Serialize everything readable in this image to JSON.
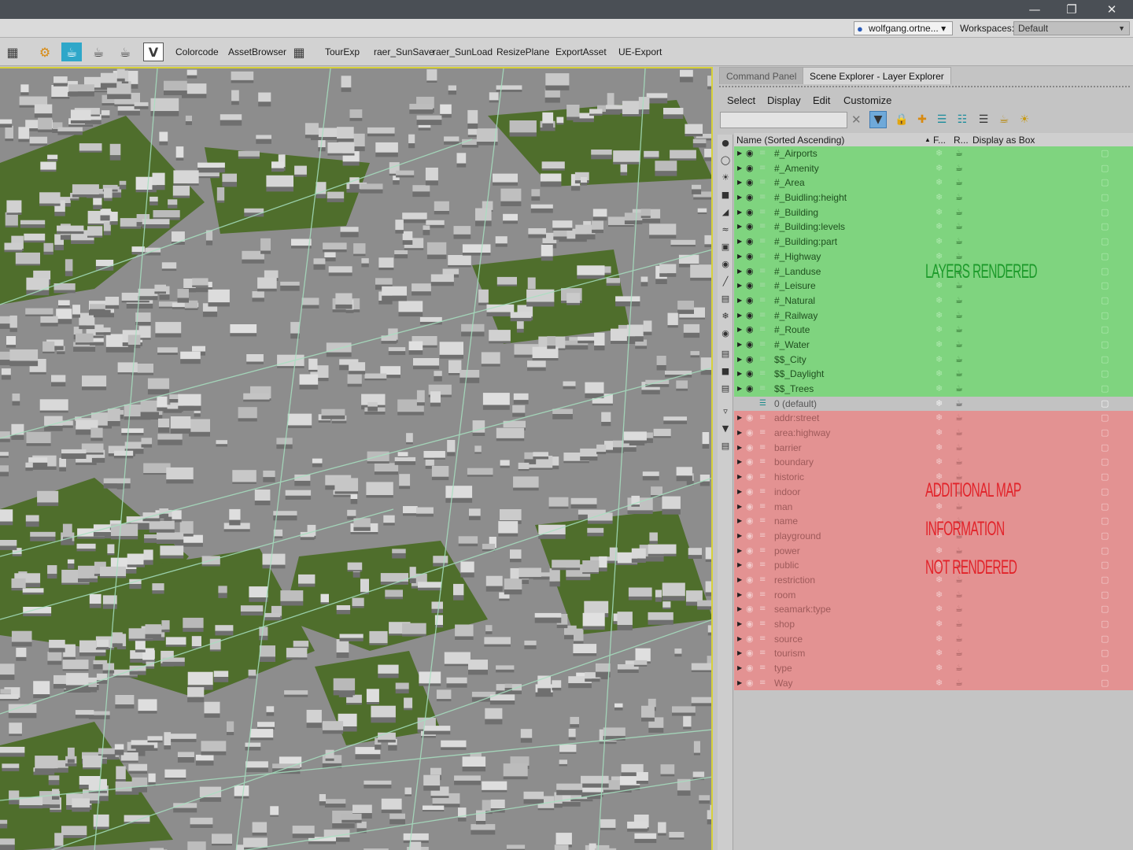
{
  "window": {
    "minimize_icon": "minimize-icon",
    "restore_icon": "restore-icon",
    "close_icon": "close-icon"
  },
  "menubar": {
    "user": "wolfgang.ortne...",
    "workspaces_label": "Workspaces:",
    "workspace_value": "Default"
  },
  "toolbar": {
    "buttons": [
      "Colorcode",
      "AssetBrowser",
      "TourExp",
      "raer_SunSave",
      "raer_SunLoad",
      "ResizePlane",
      "ExportAsset",
      "UE-Export"
    ]
  },
  "panel": {
    "tabs": [
      "Command Panel",
      "Scene Explorer - Layer Explorer"
    ],
    "menu": [
      "Select",
      "Display",
      "Edit",
      "Customize"
    ],
    "search_value": "",
    "columns": {
      "name": "Name (Sorted Ascending)",
      "frozen": "F...",
      "render": "R...",
      "display_box": "Display as Box"
    },
    "rendered_layers": [
      "#_Airports",
      "#_Amenity",
      "#_Area",
      "#_Buidling:height",
      "#_Building",
      "#_Building:levels",
      "#_Building:part",
      "#_Highway",
      "#_Landuse",
      "#_Leisure",
      "#_Natural",
      "#_Railway",
      "#_Route",
      "#_Water",
      "$$_City",
      "$$_Daylight",
      "$$_Trees"
    ],
    "default_layer": "0 (default)",
    "hidden_layers": [
      "addr:street",
      "area:highway",
      "barrier",
      "boundary",
      "historic",
      "indoor",
      "man",
      "name",
      "playground",
      "power",
      "public",
      "restriction",
      "room",
      "seamark:type",
      "shop",
      "source",
      "tourism",
      "type",
      "Way"
    ],
    "annotations": {
      "rendered": "LAYERS RENDERED",
      "not_rendered_1": "ADDITIONAL MAP",
      "not_rendered_2": "INFORMATION",
      "not_rendered_3": "NOT RENDERED"
    }
  },
  "colors": {
    "rendered_row": "#7fd47f",
    "default_row": "#c2c2c2",
    "hidden_row": "#e39292",
    "viewport_border": "#d6d03a"
  }
}
